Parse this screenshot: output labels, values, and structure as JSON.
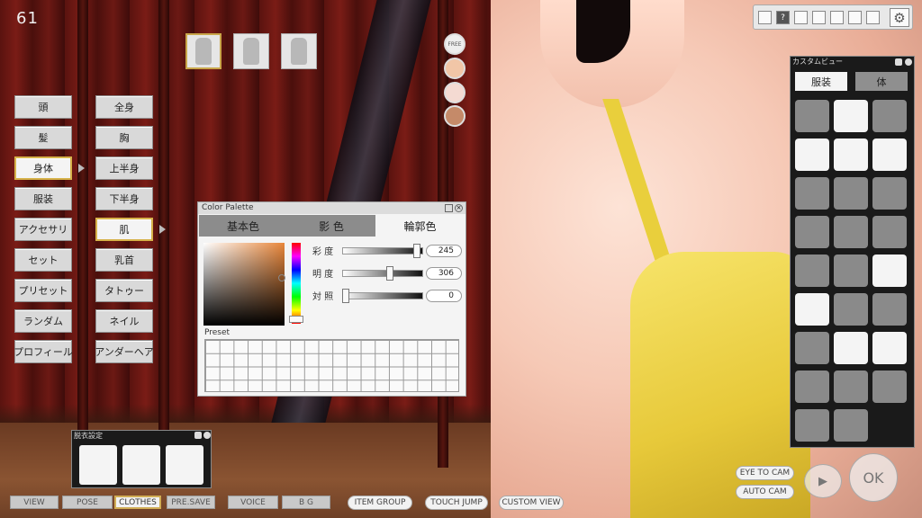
{
  "counter": "61",
  "menu_main": [
    "頭",
    "髪",
    "身体",
    "服装",
    "アクセサリ",
    "セット",
    "プリセット",
    "ランダム",
    "プロフィール"
  ],
  "menu_main_selected": 2,
  "menu_sub": [
    "全身",
    "胸",
    "上半身",
    "下半身",
    "肌",
    "乳首",
    "タトゥー",
    "ネイル",
    "アンダーヘア"
  ],
  "menu_sub_selected": 4,
  "swatches": {
    "free_label": "FREE",
    "colors": [
      "#f1c6a7",
      "#f4dad2",
      "#c58a69"
    ]
  },
  "palette": {
    "title": "Color Palette",
    "tabs": [
      "基本色",
      "影 色",
      "輪郭色"
    ],
    "active_tab": 2,
    "sliders": [
      {
        "label": "彩 度",
        "value": "245",
        "level": 0.96
      },
      {
        "label": "明 度",
        "value": "306",
        "level": 0.6
      },
      {
        "label": "対 照",
        "value": "0",
        "level": 0.0
      }
    ],
    "preset_label": "Preset"
  },
  "toolbar": {
    "icons": [
      "power-icon",
      "help-icon",
      "info-icon",
      "chart-icon",
      "swap-icon",
      "camera-icon",
      "link-icon"
    ],
    "help_glyph": "?"
  },
  "custom_view": {
    "title": "カスタムビュー",
    "tabs": [
      "服装",
      "体"
    ]
  },
  "undress": {
    "title": "脱衣設定"
  },
  "bottom_bar": {
    "tabs": [
      "VIEW",
      "POSE",
      "CLOTHES",
      "PRE.SAVE",
      "VOICE",
      "B G"
    ],
    "selected": 2,
    "pills": [
      "ITEM GROUP",
      "TOUCH JUMP",
      "CUSTOM VIEW"
    ]
  },
  "cam_buttons": [
    "EYE TO CAM",
    "AUTO CAM"
  ],
  "ok_label": "OK"
}
